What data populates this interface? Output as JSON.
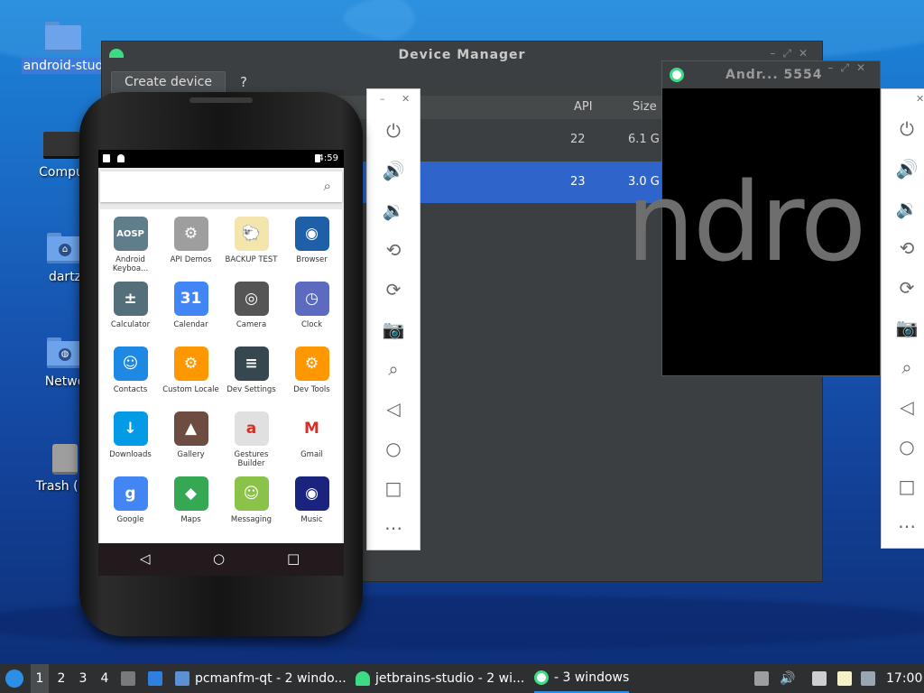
{
  "desktop": {
    "icons": [
      {
        "label": "android-stud",
        "selected": true
      },
      {
        "label": "Compu"
      },
      {
        "label": "dartz"
      },
      {
        "label": "Netwo"
      },
      {
        "label": "Trash (En"
      }
    ]
  },
  "device_manager": {
    "title": "Device Manager",
    "create_label": "Create device",
    "help_label": "?",
    "columns": [
      "API",
      "Size"
    ],
    "rows": [
      {
        "api": "22",
        "size": "6.1 G",
        "selected": false
      },
      {
        "api": "23",
        "size": "3.0 G",
        "selected": true
      }
    ]
  },
  "emulator_window": {
    "title": "Andr... 5554",
    "boot_text": "ndro"
  },
  "phone": {
    "time": "4:59",
    "apps": [
      {
        "label": "Android Keyboa...",
        "color": "#607d8b",
        "glyph": "AOSP"
      },
      {
        "label": "API Demos",
        "color": "#9e9e9e",
        "glyph": "⚙"
      },
      {
        "label": "BACKUP TEST",
        "color": "#f3e5ab",
        "glyph": "🐑"
      },
      {
        "label": "Browser",
        "color": "#1e5fa8",
        "glyph": "◉"
      },
      {
        "label": "Calculator",
        "color": "#546e7a",
        "glyph": "±"
      },
      {
        "label": "Calendar",
        "color": "#4285f4",
        "glyph": "31"
      },
      {
        "label": "Camera",
        "color": "#555555",
        "glyph": "◎"
      },
      {
        "label": "Clock",
        "color": "#5c6bc0",
        "glyph": "◷"
      },
      {
        "label": "Contacts",
        "color": "#1e88e5",
        "glyph": "☺"
      },
      {
        "label": "Custom Locale",
        "color": "#ff9800",
        "glyph": "⚙"
      },
      {
        "label": "Dev Settings",
        "color": "#37474f",
        "glyph": "≡"
      },
      {
        "label": "Dev Tools",
        "color": "#ff9800",
        "glyph": "⚙"
      },
      {
        "label": "Downloads",
        "color": "#039be5",
        "glyph": "↓"
      },
      {
        "label": "Gallery",
        "color": "#6d4c41",
        "glyph": "▲"
      },
      {
        "label": "Gestures Builder",
        "color": "#e0e0e0",
        "glyph": "a"
      },
      {
        "label": "Gmail",
        "color": "#ffffff",
        "glyph": "M"
      },
      {
        "label": "Google",
        "color": "#4285f4",
        "glyph": "g"
      },
      {
        "label": "Maps",
        "color": "#34a853",
        "glyph": "◆"
      },
      {
        "label": "Messaging",
        "color": "#8bc34a",
        "glyph": "☺"
      },
      {
        "label": "Music",
        "color": "#1a237e",
        "glyph": "◉"
      }
    ]
  },
  "panel_icons": [
    "power-icon",
    "volume-up-icon",
    "volume-down-icon",
    "rotate-left-icon",
    "rotate-right-icon",
    "screenshot-icon",
    "zoom-icon",
    "back-icon",
    "home-icon",
    "overview-icon",
    "more-icon"
  ],
  "taskbar": {
    "workspaces": [
      "1",
      "2",
      "3",
      "4"
    ],
    "tasks": [
      {
        "label": "pcmanfm-qt - 2 windo...",
        "color": "#5b8fd6"
      },
      {
        "label": "jetbrains-studio - 2 wi...",
        "color": "#3ddc84"
      },
      {
        "label": "- 3 windows",
        "color": "#ffffff"
      }
    ],
    "clock": "17:00"
  }
}
